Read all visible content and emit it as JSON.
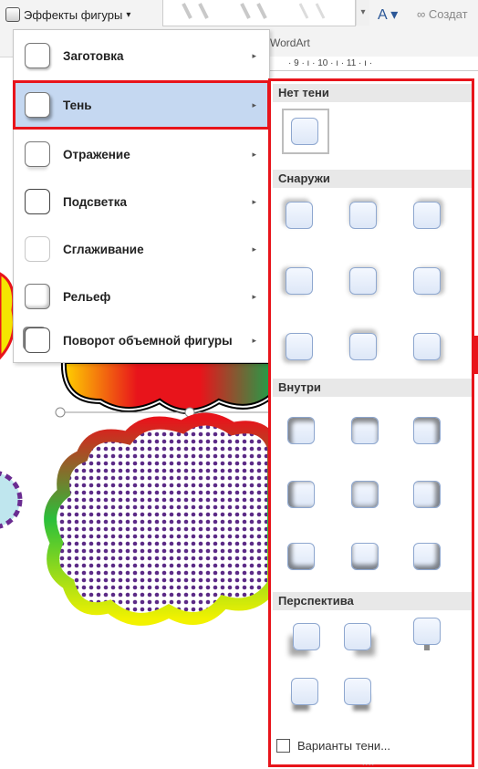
{
  "ribbon": {
    "effects_button": "Эффекты фигуры",
    "effects_caret": "▾",
    "create_link": "Создат",
    "wordart_label": "WordArt",
    "text_fill_caret": "A ▾",
    "ruler": "· 9 · ı · 10 · ı · 11 · ı ·"
  },
  "menu": {
    "items": [
      {
        "label": "Заготовка",
        "icon": "preset-icon"
      },
      {
        "label": "Тень",
        "icon": "shadow-icon"
      },
      {
        "label": "Отражение",
        "icon": "reflection-icon"
      },
      {
        "label": "Подсветка",
        "icon": "glow-icon"
      },
      {
        "label": "Сглаживание",
        "icon": "soft-edges-icon"
      },
      {
        "label": "Рельеф",
        "icon": "bevel-icon"
      },
      {
        "label": "Поворот объемной фигуры",
        "icon": "3d-rotation-icon"
      }
    ],
    "arrow": "▸"
  },
  "submenu": {
    "sections": {
      "none": "Нет тени",
      "outer": "Снаружи",
      "inner": "Внутри",
      "perspective": "Перспектива"
    },
    "options_label": "Варианты тени...",
    "grip": "....",
    "accent_color": "#e8141b",
    "highlight_color": "#c5d8f1"
  }
}
